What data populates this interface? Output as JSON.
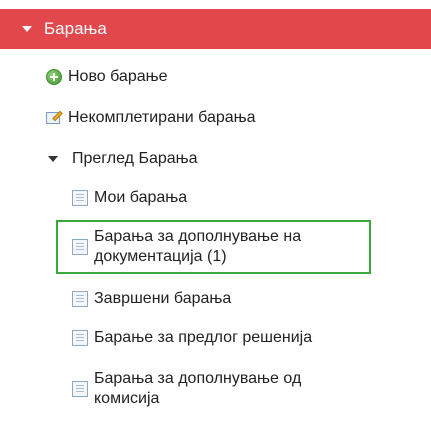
{
  "header": {
    "title": "Барања"
  },
  "menu": {
    "new_request": "Ново барање",
    "incomplete_requests": "Некомплетирани барања",
    "review_section": "Преглед Барања",
    "my_requests": "Мои барања",
    "requests_for_docs_line1": "Барања за дополнување на",
    "requests_for_docs_line2": "документација (1)",
    "completed_requests": "Завршени барања",
    "proposal_request": "Барање за предлог решенија",
    "commission_line1": "Барања за дополнување од",
    "commission_line2": "комисија"
  },
  "icons": {
    "new_request": "add-circle-icon",
    "incomplete_requests": "edit-document-icon",
    "doc_items": "document-icon"
  },
  "colors": {
    "header_bg": "#e2474c",
    "highlight_border": "#3aa83a"
  }
}
